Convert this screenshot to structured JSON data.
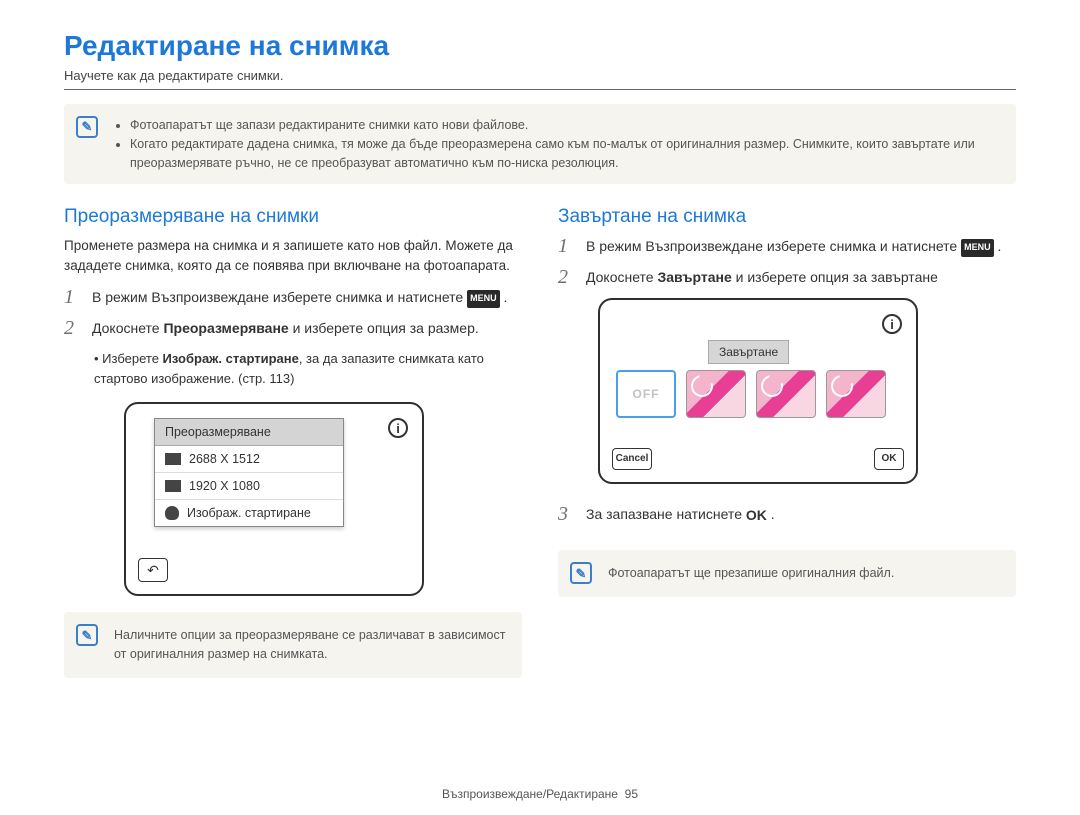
{
  "title": "Редактиране на снимка",
  "subtitle": "Научете как да редактирате снимки.",
  "top_notes": {
    "items": [
      "Фотоапаратът ще запази редактираните снимки като нови файлове.",
      "Когато редактирате дадена снимка, тя може да бъде преоразмерена само към по-малък от оригиналния размер. Снимките, които завъртате или преоразмерявате ръчно, не се преобразуват автоматично към по-ниска резолюция."
    ]
  },
  "left": {
    "heading": "Преоразмеряване на снимки",
    "intro": "Променете размера на снимка и я запишете като нов файл. Можете да зададете снимка, която да се появява при включване на фотоапарата.",
    "step1_a": "В режим Възпроизвеждане изберете снимка и натиснете ",
    "menu_label": "MENU",
    "step1_b": " .",
    "step2_a": "Докоснете ",
    "step2_bold": "Преоразмеряване",
    "step2_b": " и изберете опция за размер.",
    "sub_a": "Изберете ",
    "sub_bold": "Изображ. стартиране",
    "sub_b": ", за да запазите снимката като стартово изображение. (стр. 113)",
    "dropdown": {
      "title": "Преоразмеряване",
      "opt1": "2688 X 1512",
      "opt2": "1920 X 1080",
      "opt3": "Изображ. стартиране"
    },
    "note": "Наличните опции за преоразмеряване се различават в зависимост от оригиналния размер на снимката."
  },
  "right": {
    "heading": "Завъртане на снимка",
    "step1_a": "В режим Възпроизвеждане изберете снимка и натиснете ",
    "menu_label": "MENU",
    "step1_b": " .",
    "step2_a": "Докоснете ",
    "step2_bold": "Завъртане",
    "step2_b": " и изберете опция за завъртане",
    "rotate_label": "Завъртане",
    "off_label": "OFF",
    "cancel_label": "Cancel",
    "ok_label": "OK",
    "step3_a": "За запазване натиснете ",
    "step3_ok": "OK",
    "step3_b": " .",
    "note": "Фотоапаратът ще презапише оригиналния файл."
  },
  "footer": {
    "section": "Възпроизвеждане/Редактиране",
    "page": "95"
  }
}
